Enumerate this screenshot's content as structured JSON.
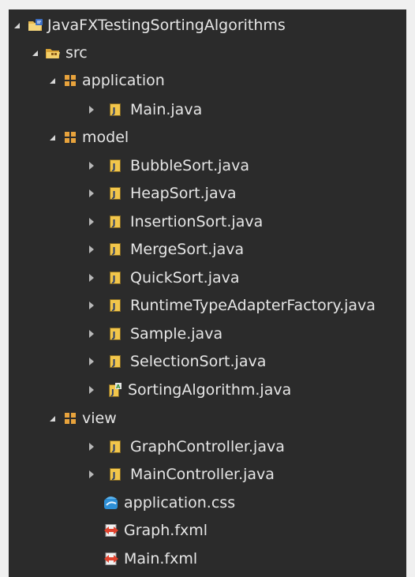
{
  "project": {
    "label": "JavaFXTestingSortingAlgorithms",
    "icon": "java-project-folder-icon"
  },
  "src_folder": {
    "label": "src",
    "icon": "source-folder-icon"
  },
  "packages": [
    {
      "label": "application",
      "icon": "package-icon",
      "children": [
        {
          "label": "Main.java",
          "icon": "java-file-icon"
        }
      ]
    },
    {
      "label": "model",
      "icon": "package-icon",
      "children": [
        {
          "label": "BubbleSort.java",
          "icon": "java-file-icon"
        },
        {
          "label": "HeapSort.java",
          "icon": "java-file-icon"
        },
        {
          "label": "InsertionSort.java",
          "icon": "java-file-icon"
        },
        {
          "label": "MergeSort.java",
          "icon": "java-file-icon"
        },
        {
          "label": "QuickSort.java",
          "icon": "java-file-icon"
        },
        {
          "label": "RuntimeTypeAdapterFactory.java",
          "icon": "java-file-icon"
        },
        {
          "label": "Sample.java",
          "icon": "java-file-icon"
        },
        {
          "label": "SelectionSort.java",
          "icon": "java-file-icon"
        },
        {
          "label": "SortingAlgorithm.java",
          "icon": "abstract-java-file-icon"
        }
      ]
    },
    {
      "label": "view",
      "icon": "package-icon",
      "children": [
        {
          "label": "GraphController.java",
          "icon": "java-file-icon"
        },
        {
          "label": "MainController.java",
          "icon": "java-file-icon"
        },
        {
          "label": "application.css",
          "icon": "css-file-icon"
        },
        {
          "label": "Graph.fxml",
          "icon": "fxml-file-icon"
        },
        {
          "label": "Main.fxml",
          "icon": "fxml-file-icon"
        }
      ]
    }
  ],
  "colors": {
    "background": "#2b2b2b",
    "text": "#e6e6e6",
    "package_icon": "#e8a33c",
    "java_icon_bg": "#f2c64b",
    "folder_icon": "#e7b94f"
  }
}
